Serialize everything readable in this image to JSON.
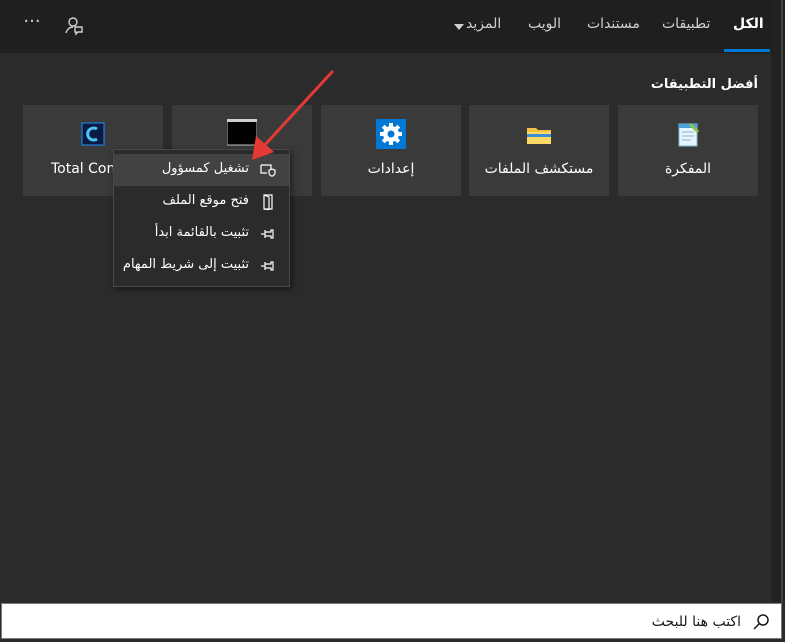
{
  "tabs": [
    {
      "label": "الكل",
      "active": true
    },
    {
      "label": "تطبيقات"
    },
    {
      "label": "مستندات"
    },
    {
      "label": "الويب"
    },
    {
      "label": "المزيد"
    }
  ],
  "toolbar": {
    "more_options": "···"
  },
  "section_title": "أفضل التطبيقات",
  "apps": [
    {
      "label": "المفكرة",
      "icon": "notepad-icon"
    },
    {
      "label": "مستكشف الملفات",
      "icon": "folder-icon"
    },
    {
      "label": "إعدادات",
      "icon": "gear-icon"
    },
    {
      "label": "",
      "icon": "terminal-icon"
    },
    {
      "label": "Total Con",
      "icon": "total-commander-icon"
    }
  ],
  "context_menu": [
    {
      "label": "تشغيل كمسؤول",
      "icon": "shield-icon",
      "highlighted": true
    },
    {
      "label": "فتح موقع الملف",
      "icon": "folder-open-icon"
    },
    {
      "label": "تثبيت بالقائمة ابدأ",
      "icon": "pin-icon"
    },
    {
      "label": "تثبيت إلى شريط المهام",
      "icon": "pin-icon"
    }
  ],
  "search": {
    "placeholder": "اكتب هنا للبحث"
  },
  "colors": {
    "accent": "#0078d4",
    "arrow": "#e53935",
    "tile_bg": "#3a3a3a",
    "background": "#2b2b2b"
  }
}
